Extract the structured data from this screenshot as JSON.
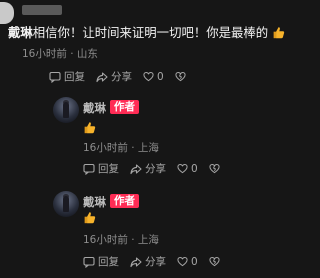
{
  "top_comment": {
    "author": "戴琳",
    "text": "相信你！让时间来证明一切吧！你是最棒的",
    "emoji_icon": "thumbs-up-icon",
    "time": "16小时前",
    "location": "山东",
    "reply_label": "回复",
    "share_label": "分享",
    "like_count": "0"
  },
  "replies": [
    {
      "author": "戴琳",
      "badge": "作者",
      "emoji_icon": "thumbs-up-icon",
      "time": "16小时前",
      "location": "上海",
      "reply_label": "回复",
      "share_label": "分享",
      "like_count": "0"
    },
    {
      "author": "戴琳",
      "badge": "作者",
      "emoji_icon": "thumbs-up-icon",
      "time": "16小时前",
      "location": "上海",
      "reply_label": "回复",
      "share_label": "分享",
      "like_count": "0"
    }
  ],
  "colors": {
    "background": "#161616",
    "author_badge": "#ff2c55",
    "thumb_emoji": "#f7b32b"
  }
}
